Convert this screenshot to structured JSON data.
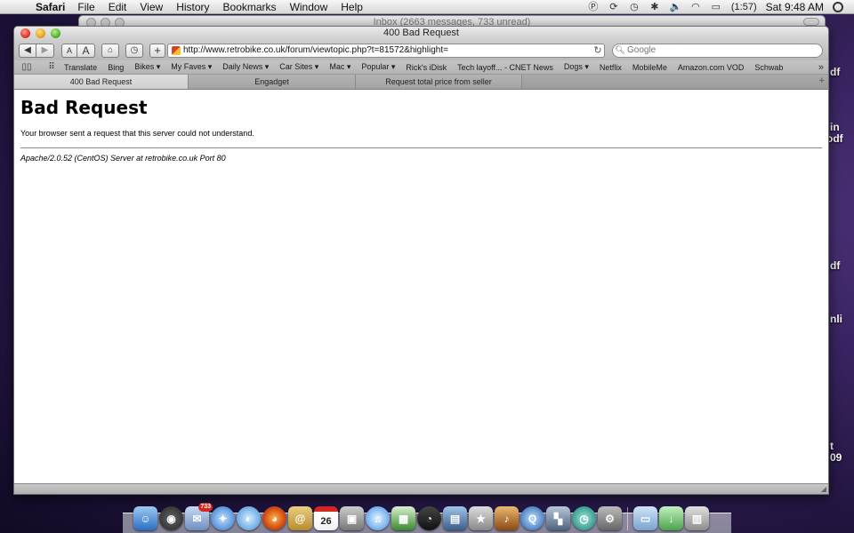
{
  "menubar": {
    "app_name": "Safari",
    "menus": [
      "File",
      "Edit",
      "View",
      "History",
      "Bookmarks",
      "Window",
      "Help"
    ],
    "battery": "(1:57)",
    "clock": "Sat 9:48 AM"
  },
  "desktop_labels": [
    "df",
    "in",
    "odf",
    "df",
    "nli",
    "t",
    "09"
  ],
  "mail_window": {
    "title": "Inbox (2663 messages, 733 unread)"
  },
  "safari": {
    "window_title": "400 Bad Request",
    "toolbar": {
      "text_small": "A",
      "text_large": "A",
      "add_bookmark": "+",
      "address": "http://www.retrobike.co.uk/forum/viewtopic.php?t=81572&highlight=",
      "search_placeholder": "Google"
    },
    "bookmarks": [
      "Translate",
      "Bing",
      "Bikes ▾",
      "My Faves ▾",
      "Daily News ▾",
      "Car Sites ▾",
      "Mac ▾",
      "Popular ▾",
      "Rick's iDisk",
      "Tech layoff... - CNET News",
      "Dogs ▾",
      "Netflix",
      "MobileMe",
      "Amazon.com VOD",
      "Schwab"
    ],
    "tabs": [
      {
        "label": "400 Bad Request"
      },
      {
        "label": "Engadget"
      },
      {
        "label": "Request total price from seller"
      }
    ],
    "page": {
      "heading": "Bad Request",
      "message": "Your browser sent a request that this server could not understand.",
      "server_signature": "Apache/2.0.52 (CentOS) Server at retrobike.co.uk Port 80"
    }
  },
  "dock": {
    "calendar_day": "26",
    "mail_badge": "733"
  }
}
